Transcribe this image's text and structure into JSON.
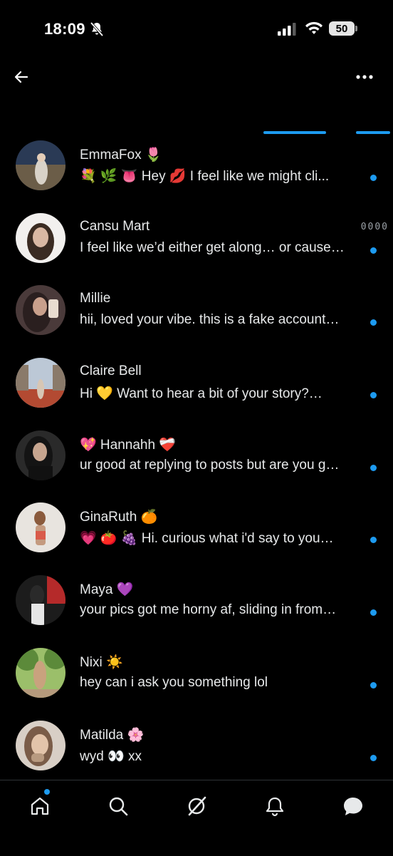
{
  "status_bar": {
    "time": "18:09",
    "battery": "50",
    "icons": [
      "bell-off-icon",
      "signal-icon",
      "wifi-icon",
      "battery-icon"
    ]
  },
  "header": {
    "icons": [
      "back-arrow-icon",
      "more-icon"
    ]
  },
  "conversations": [
    {
      "name": "EmmaFox 🌷",
      "preview": "💐 🌿 👅 Hey 💋 I feel like we might cli...",
      "timestamp": "",
      "unread": true,
      "avatar_colors": [
        "#2a3a55",
        "#6b5d48",
        "#d8d2c8"
      ]
    },
    {
      "name": "Cansu Mart",
      "preview": "I feel like we’d either get along… or cause…",
      "timestamp": "0000",
      "unread": true,
      "avatar_colors": [
        "#f2f0ee",
        "#3a2b22",
        "#d9b8a3"
      ]
    },
    {
      "name": "Millie",
      "preview": "hii, loved your vibe. this is a fake account…",
      "timestamp": "",
      "unread": true,
      "avatar_colors": [
        "#4a3a3a",
        "#2a1f1f",
        "#c9a08c"
      ]
    },
    {
      "name": "Claire Bell",
      "preview": "Hi 💛 Want to hear a bit of your story?…",
      "timestamp": "",
      "unread": true,
      "avatar_colors": [
        "#bcc8d6",
        "#b34a32",
        "#8a7a6a"
      ]
    },
    {
      "name": "💖 Hannahh ❤️‍🩹",
      "preview": "ur good at replying to posts but are you g…",
      "timestamp": "",
      "unread": true,
      "avatar_colors": [
        "#2a2a2a",
        "#141414",
        "#c7a58f"
      ]
    },
    {
      "name": "GinaRuth 🍊",
      "preview": "💗 🍅 🍇 Hi. curious what i'd say to you…",
      "timestamp": "",
      "unread": true,
      "avatar_colors": [
        "#e8e4df",
        "#d95a4a",
        "#c49a7f"
      ]
    },
    {
      "name": "Maya 💜",
      "preview": "your pics got me horny af, sliding in from…",
      "timestamp": "",
      "unread": true,
      "avatar_colors": [
        "#1c1c1c",
        "#b52a2a",
        "#e6e6e6"
      ]
    },
    {
      "name": "Nixi ☀️",
      "preview": "hey can i ask you something lol",
      "timestamp": "",
      "unread": true,
      "avatar_colors": [
        "#5c8a3a",
        "#9bbf6a",
        "#c9a27e"
      ]
    },
    {
      "name": "Matilda 🌸",
      "preview": "wyd 👀 xx",
      "timestamp": "",
      "unread": true,
      "avatar_colors": [
        "#d8cfc6",
        "#b89a80",
        "#7a5c48"
      ]
    }
  ],
  "bottom_nav": {
    "items": [
      "home-icon",
      "search-icon",
      "grok-icon",
      "notifications-icon",
      "messages-icon"
    ],
    "colors": {
      "accent": "#1d9bf0",
      "icon": "#e7e9ea"
    }
  }
}
